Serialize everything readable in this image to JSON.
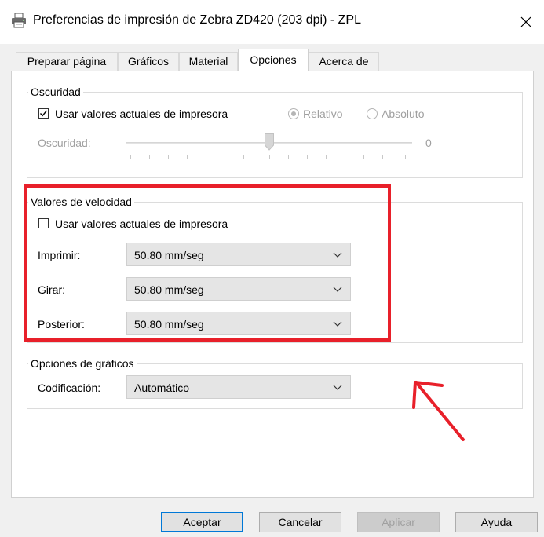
{
  "window": {
    "title": "Preferencias de impresión de Zebra ZD420 (203 dpi) - ZPL",
    "icon": "printer-icon",
    "close_icon": "close-icon"
  },
  "tabs": [
    {
      "label": "Preparar página",
      "active": false
    },
    {
      "label": "Gráficos",
      "active": false
    },
    {
      "label": "Material",
      "active": false
    },
    {
      "label": "Opciones",
      "active": true
    },
    {
      "label": "Acerca de",
      "active": false
    }
  ],
  "oscuridad": {
    "legend": "Oscuridad",
    "checkbox_label": "Usar valores actuales de impresora",
    "checkbox_checked": true,
    "radio_relativo": "Relativo",
    "radio_absoluto": "Absoluto",
    "selected_radio": "Relativo",
    "slider_label": "Oscuridad:",
    "slider_value": "0"
  },
  "velocidad": {
    "legend": "Valores de velocidad",
    "checkbox_label": "Usar valores actuales de impresora",
    "checkbox_checked": false,
    "imprimir_label": "Imprimir:",
    "imprimir_value": "50.80 mm/seg",
    "girar_label": "Girar:",
    "girar_value": "50.80 mm/seg",
    "posterior_label": "Posterior:",
    "posterior_value": "50.80 mm/seg"
  },
  "graficos": {
    "legend": "Opciones de gráficos",
    "codificacion_label": "Codificación:",
    "codificacion_value": "Automático"
  },
  "buttons": {
    "aceptar": "Aceptar",
    "cancelar": "Cancelar",
    "aplicar": "Aplicar",
    "ayuda": "Ayuda"
  },
  "annotation_color": "#e8202a"
}
